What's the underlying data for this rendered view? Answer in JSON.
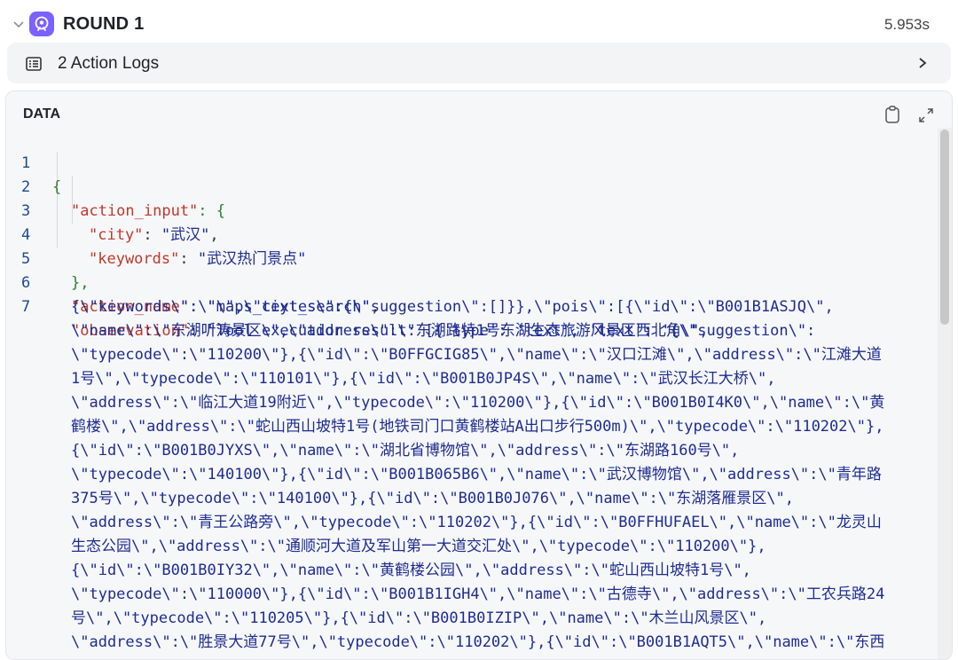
{
  "round": {
    "title": "ROUND 1",
    "time": "5.953s"
  },
  "action_logs": {
    "label": "2 Action Logs"
  },
  "panel": {
    "title": "DATA"
  },
  "code": {
    "line_numbers": [
      "1",
      "2",
      "3",
      "4",
      "5",
      "6",
      "7"
    ],
    "l1": "{",
    "l2_key": "\"action_input\"",
    "l2_rest": ": {",
    "l3_key": "\"city\"",
    "l3_val": "\"武汉\"",
    "l4_key": "\"keywords\"",
    "l4_val": "\"武汉热门景点\"",
    "l5": "},",
    "l6_key": "\"action_name\"",
    "l6_val": "\"maps_text_search\"",
    "l7_key": "\"observation\"",
    "l7_first": "\"Tool execution result: [{'type': 'text', 'text': '{\\\"suggestion\\\":",
    "wrapped": [
      "{\\\"keywords\\\":\\\"\\\",\\\"ciytes\\\":{\\\"suggestion\\\":[]}},\\\"pois\\\":[{\\\"id\\\":\\\"B001B1ASJQ\\\",",
      "\\\"name\\\":\\\"东湖听涛景区\\\",\\\"address\\\":\\\"东湖路特1号东湖生态旅游风景区西北角\\\",",
      "\\\"typecode\\\":\\\"110200\\\"},{\\\"id\\\":\\\"B0FFGCIG85\\\",\\\"name\\\":\\\"汉口江滩\\\",\\\"address\\\":\\\"江滩大道",
      "1号\\\",\\\"typecode\\\":\\\"110101\\\"},{\\\"id\\\":\\\"B001B0JP4S\\\",\\\"name\\\":\\\"武汉长江大桥\\\",",
      "\\\"address\\\":\\\"临江大道19附近\\\",\\\"typecode\\\":\\\"110200\\\"},{\\\"id\\\":\\\"B001B0I4K0\\\",\\\"name\\\":\\\"黄",
      "鹤楼\\\",\\\"address\\\":\\\"蛇山西山坡特1号(地铁司门口黄鹤楼站A出口步行500m)\\\",\\\"typecode\\\":\\\"110202\\\"},",
      "{\\\"id\\\":\\\"B001B0JYXS\\\",\\\"name\\\":\\\"湖北省博物馆\\\",\\\"address\\\":\\\"东湖路160号\\\",",
      "\\\"typecode\\\":\\\"140100\\\"},{\\\"id\\\":\\\"B001B065B6\\\",\\\"name\\\":\\\"武汉博物馆\\\",\\\"address\\\":\\\"青年路",
      "375号\\\",\\\"typecode\\\":\\\"140100\\\"},{\\\"id\\\":\\\"B001B0J076\\\",\\\"name\\\":\\\"东湖落雁景区\\\",",
      "\\\"address\\\":\\\"青王公路旁\\\",\\\"typecode\\\":\\\"110202\\\"},{\\\"id\\\":\\\"B0FFHUFAEL\\\",\\\"name\\\":\\\"龙灵山",
      "生态公园\\\",\\\"address\\\":\\\"通顺河大道及军山第一大道交汇处\\\",\\\"typecode\\\":\\\"110200\\\"},",
      "{\\\"id\\\":\\\"B001B0IY32\\\",\\\"name\\\":\\\"黄鹤楼公园\\\",\\\"address\\\":\\\"蛇山西山坡特1号\\\",",
      "\\\"typecode\\\":\\\"110000\\\"},{\\\"id\\\":\\\"B001B1IGH4\\\",\\\"name\\\":\\\"古德寺\\\",\\\"address\\\":\\\"工农兵路24",
      "号\\\",\\\"typecode\\\":\\\"110205\\\"},{\\\"id\\\":\\\"B001B0IZIP\\\",\\\"name\\\":\\\"木兰山风景区\\\",",
      "\\\"address\\\":\\\"胜景大道77号\\\",\\\"typecode\\\":\\\"110202\\\"},{\\\"id\\\":\\\"B001B1AQT5\\\",\\\"name\\\":\\\"东西"
    ]
  }
}
